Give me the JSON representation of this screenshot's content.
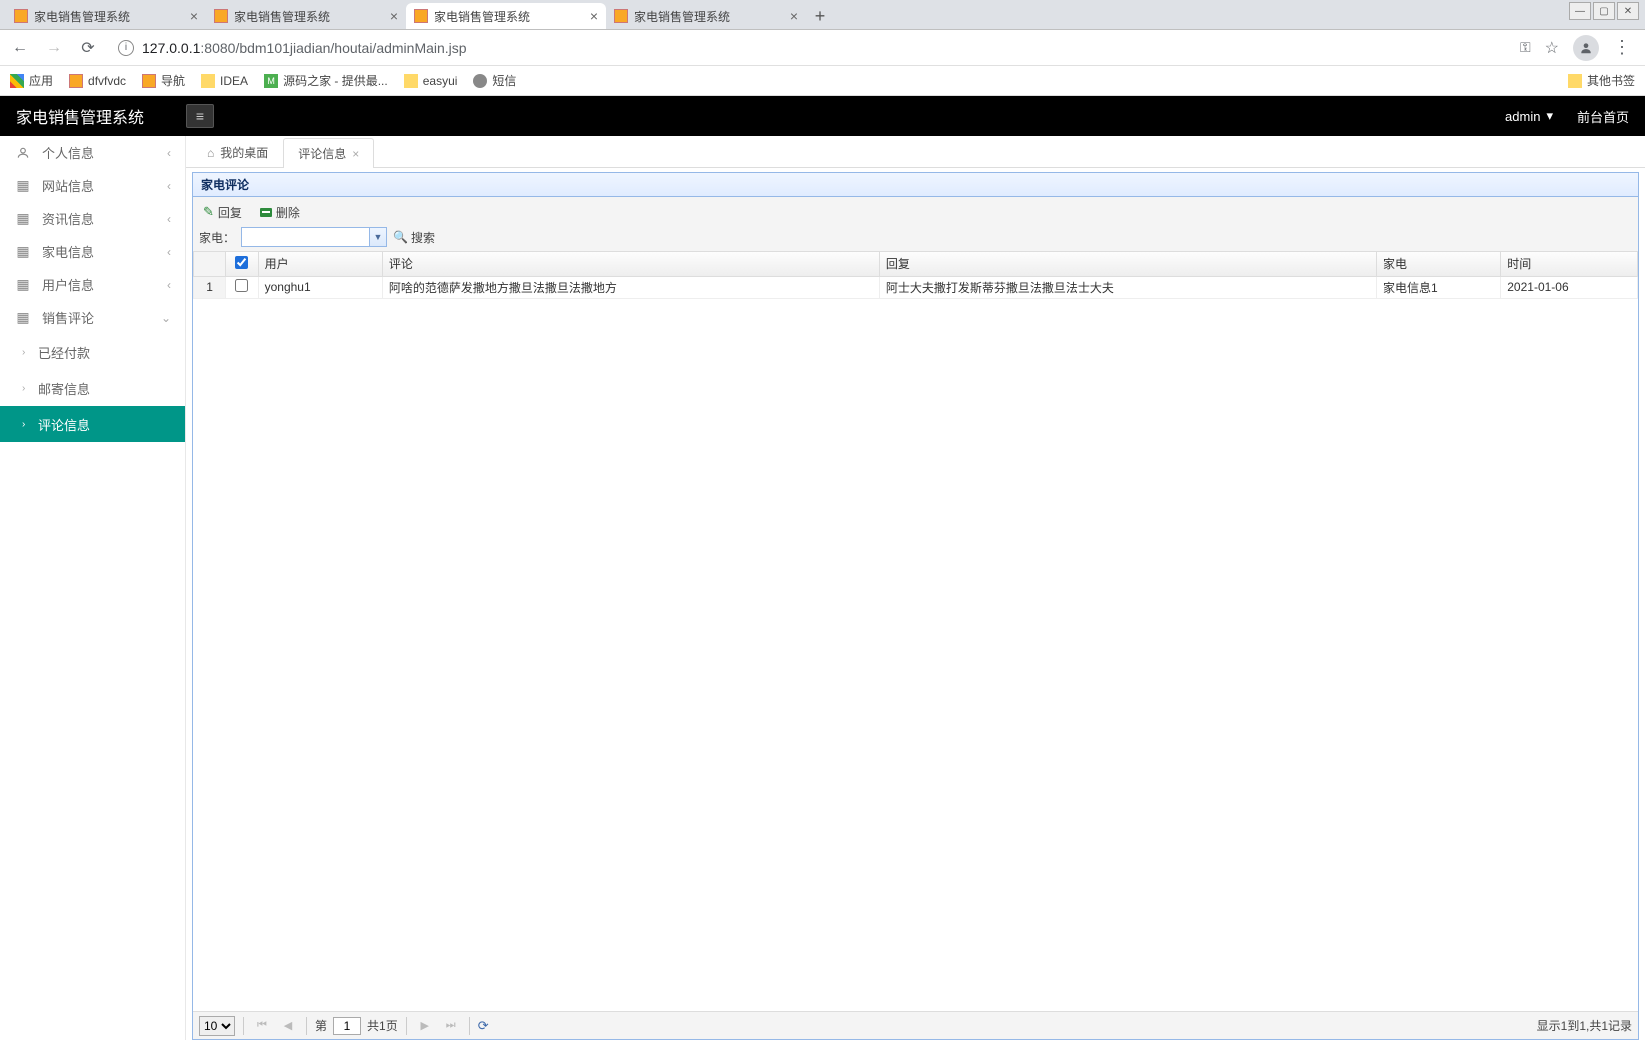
{
  "browser": {
    "tabs": [
      {
        "title": "家电销售管理系统",
        "active": false
      },
      {
        "title": "家电销售管理系统",
        "active": false
      },
      {
        "title": "家电销售管理系统",
        "active": true
      },
      {
        "title": "家电销售管理系统",
        "active": false
      }
    ],
    "url_host": "127.0.0.1",
    "url_port": ":8080",
    "url_path": "/bdm101jiadian/houtai/adminMain.jsp"
  },
  "bookmarks": {
    "apps": "应用",
    "items": [
      "dfvfvdc",
      "导航",
      "IDEA",
      "源码之家 - 提供最...",
      "easyui",
      "短信"
    ],
    "other": "其他书签"
  },
  "app": {
    "title": "家电销售管理系统",
    "admin": "admin",
    "front_link": "前台首页"
  },
  "sidebar": {
    "items": [
      {
        "label": "个人信息"
      },
      {
        "label": "网站信息"
      },
      {
        "label": "资讯信息"
      },
      {
        "label": "家电信息"
      },
      {
        "label": "用户信息"
      },
      {
        "label": "销售评论",
        "expanded": true
      }
    ],
    "subs": [
      {
        "label": "已经付款"
      },
      {
        "label": "邮寄信息"
      },
      {
        "label": "评论信息",
        "active": true
      }
    ]
  },
  "tabs": {
    "home": "我的桌面",
    "current": "评论信息"
  },
  "panel": {
    "title": "家电评论",
    "toolbar": {
      "reply": "回复",
      "delete": "删除"
    },
    "search": {
      "label": "家电：",
      "value": "",
      "button": "搜索"
    },
    "columns": {
      "user": "用户",
      "comment": "评论",
      "reply": "回复",
      "product": "家电",
      "time": "时间"
    },
    "rows": [
      {
        "num": "1",
        "user": "yonghu1",
        "comment": "阿啥的范德萨发撒地方撒旦法撒旦法撒地方",
        "reply": "阿士大夫撒打发斯蒂芬撒旦法撒旦法士大夫",
        "product": "家电信息1",
        "time": "2021-01-06"
      }
    ],
    "pager": {
      "page_size": "10",
      "di": "第",
      "page": "1",
      "total_pages": "共1页",
      "info": "显示1到1,共1记录"
    }
  }
}
